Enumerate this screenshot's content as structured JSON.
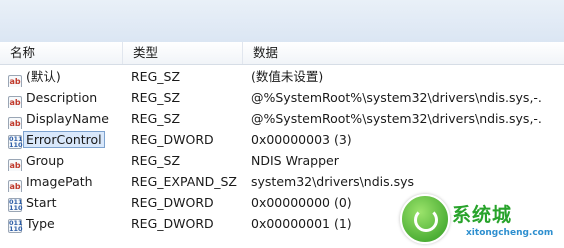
{
  "columns": {
    "name": "名称",
    "type": "类型",
    "data": "数据"
  },
  "rows": [
    {
      "icon": "string-value-icon",
      "icon_text": "ab",
      "name": "(默认)",
      "type": "REG_SZ",
      "data": "(数值未设置)"
    },
    {
      "icon": "string-value-icon",
      "icon_text": "ab",
      "name": "Description",
      "type": "REG_SZ",
      "data": "@%SystemRoot%\\system32\\drivers\\ndis.sys,-..."
    },
    {
      "icon": "string-value-icon",
      "icon_text": "ab",
      "name": "DisplayName",
      "type": "REG_SZ",
      "data": "@%SystemRoot%\\system32\\drivers\\ndis.sys,-..."
    },
    {
      "icon": "binary-value-icon",
      "icon_text": "011\n110",
      "name": "ErrorControl",
      "type": "REG_DWORD",
      "data": "0x00000003 (3)",
      "selected": true
    },
    {
      "icon": "string-value-icon",
      "icon_text": "ab",
      "name": "Group",
      "type": "REG_SZ",
      "data": "NDIS Wrapper"
    },
    {
      "icon": "string-value-icon",
      "icon_text": "ab",
      "name": "ImagePath",
      "type": "REG_EXPAND_SZ",
      "data": "system32\\drivers\\ndis.sys"
    },
    {
      "icon": "binary-value-icon",
      "icon_text": "011\n110",
      "name": "Start",
      "type": "REG_DWORD",
      "data": "0x00000000 (0)"
    },
    {
      "icon": "binary-value-icon",
      "icon_text": "011\n110",
      "name": "Type",
      "type": "REG_DWORD",
      "data": "0x00000001 (1)"
    }
  ],
  "watermark": {
    "text": "系统城",
    "url": "xitongcheng.com"
  }
}
